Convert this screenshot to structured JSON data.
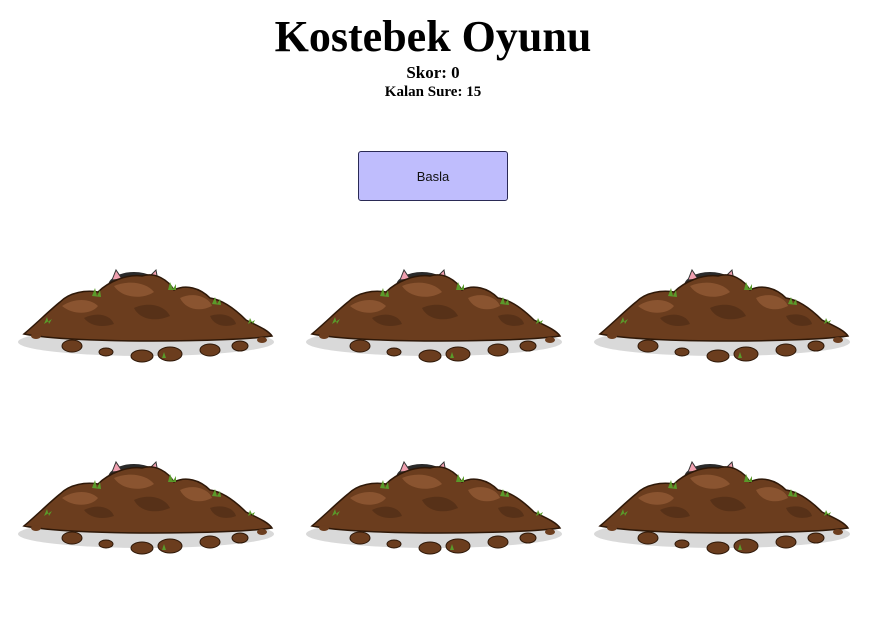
{
  "game": {
    "title": "Kostebek Oyunu",
    "score_text": "Skor: 0",
    "timer_text": "Kalan Sure: 15",
    "start_button_label": "Basla"
  },
  "holes": [
    {
      "id": "hole-1",
      "icon": "mole-hill"
    },
    {
      "id": "hole-2",
      "icon": "mole-hill"
    },
    {
      "id": "hole-3",
      "icon": "mole-hill"
    },
    {
      "id": "hole-4",
      "icon": "mole-hill"
    },
    {
      "id": "hole-5",
      "icon": "mole-hill"
    },
    {
      "id": "hole-6",
      "icon": "mole-hill"
    }
  ],
  "colors": {
    "button_bg": "#bfbdfd",
    "dirt_dark": "#4a2a14",
    "dirt_mid": "#6b3d1e",
    "dirt_light": "#8a5430",
    "grass": "#5a9a2a",
    "mole": "#2a2a2a",
    "ear": "#f0a0b0"
  }
}
